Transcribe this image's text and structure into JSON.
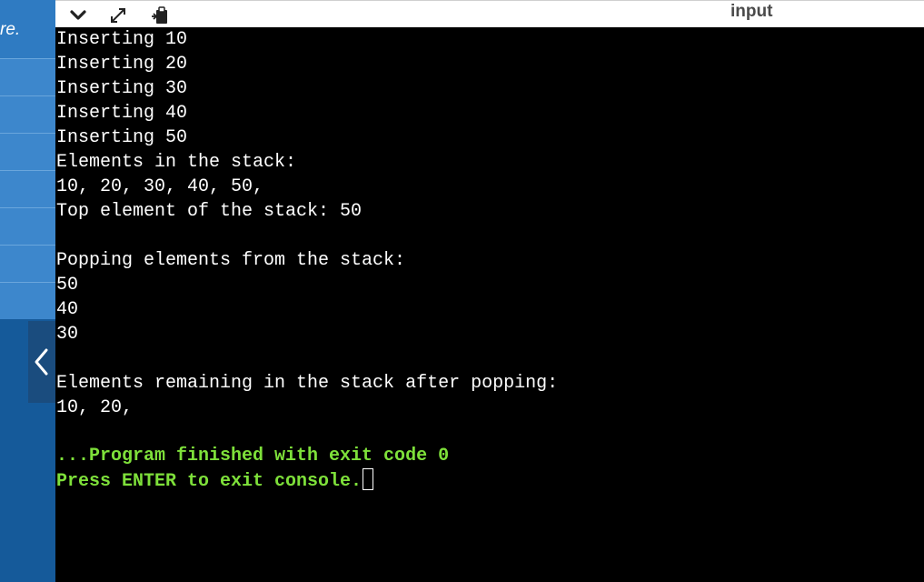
{
  "sidebar": {
    "top_text": "re."
  },
  "toolbar": {
    "title": "input",
    "icons": [
      "chevron-down-icon",
      "expand-icon",
      "clipboard-icon"
    ]
  },
  "console": {
    "lines": [
      "Inserting 10",
      "Inserting 20",
      "Inserting 30",
      "Inserting 40",
      "Inserting 50",
      "Elements in the stack:",
      "10, 20, 30, 40, 50,",
      "Top element of the stack: 50",
      "",
      "Popping elements from the stack:",
      "50",
      "40",
      "30",
      "",
      "Elements remaining in the stack after popping:",
      "10, 20,"
    ],
    "finish_line": "...Program finished with exit code 0",
    "exit_prompt": "Press ENTER to exit console."
  },
  "colors": {
    "sidebar": "#155a9a",
    "sidebar_item": "#3d87cc",
    "console_bg": "#000000",
    "console_text": "#ffffff",
    "console_success": "#7ee03a"
  }
}
